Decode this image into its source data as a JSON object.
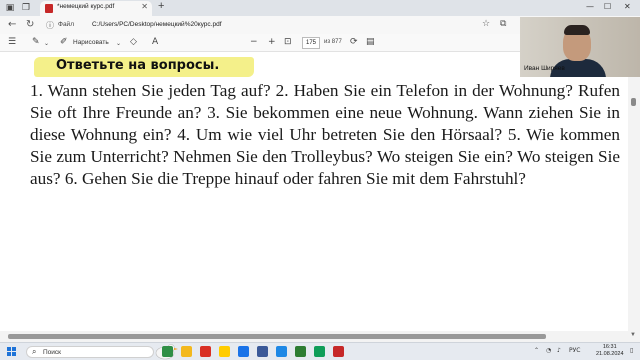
{
  "tab": {
    "title": "*немецкий курс.pdf",
    "close": "✕",
    "new": "+"
  },
  "address": {
    "info_label": "Файл",
    "url": "C:/Users/PC/Desktop/немецкий%20курс.pdf"
  },
  "pdf_toolbar": {
    "draw_label": "Нарисовать",
    "page_number": "175",
    "page_total": "из 877"
  },
  "document": {
    "heading": "Ответьте на вопросы.",
    "paragraph": "1. Wann stehen Sie jeden Tag auf? 2. Haben Sie ein Telefon in der Wohnung? Rufen Sie oft Ihre Freunde an? 3. Sie bekommen eine neue Wohnung. Wann ziehen Sie in diese Wohnung ein? 4. Um wie viel Uhr betreten Sie den Hörsaal? 5. Wie kommen Sie zum Unterricht? Nehmen Sie den Trolleybus? Wo steigen Sie ein? Wo steigen Sie aus? 6. Gehen Sie die Treppe hinauf oder fahren Sie mit dem Fahrstuhl?"
  },
  "webcam": {
    "name": "Иван Ширяев"
  },
  "taskbar": {
    "search_label": "Поиск",
    "lang": "РУС",
    "time": "16:31",
    "date": "21.08.2024",
    "app_colors": [
      "#2f8f46",
      "#f3b81d",
      "#d93025",
      "#ffcc00",
      "#1a73e8",
      "#3b5998",
      "#1e88e5",
      "#2e7d32",
      "#0f9d58",
      "#c62828"
    ]
  },
  "icons": {
    "back": "back-arrow-icon",
    "refresh": "refresh-icon",
    "info": "info-icon",
    "outline": "list-icon",
    "highlight": "highlighter-icon",
    "draw": "pen-icon",
    "zoom_out": "minus-icon",
    "zoom_in": "plus-icon",
    "fit": "fit-page-icon"
  }
}
